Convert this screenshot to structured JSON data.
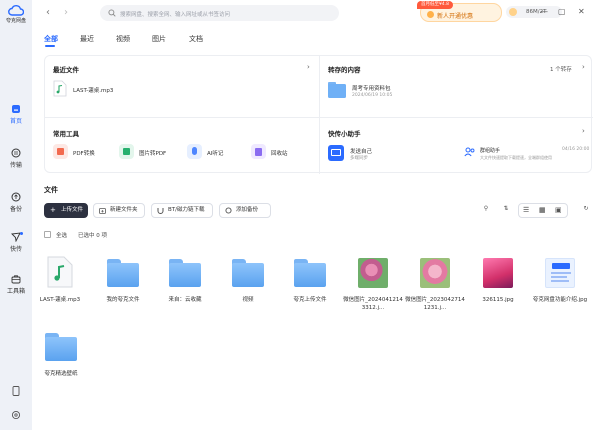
{
  "app": {
    "name": "夸克网盘"
  },
  "nav": {
    "items": [
      {
        "label": "首页",
        "icon": "home-icon",
        "active": true
      },
      {
        "label": "传输",
        "icon": "transfer-icon"
      },
      {
        "label": "备份",
        "icon": "backup-icon"
      },
      {
        "label": "快传",
        "icon": "quick-send-icon"
      },
      {
        "label": "工具箱",
        "icon": "toolbox-icon"
      }
    ]
  },
  "topbar": {
    "search_placeholder": "搜索网盘、搜索全网、输入网址或从书签访问",
    "promo_tag": "首月低至¥4.8",
    "promo_text": "新人开通优惠",
    "quota": "86M/2T"
  },
  "tabs": [
    "全部",
    "最近",
    "视频",
    "图片",
    "文档"
  ],
  "recent": {
    "title": "最近文件",
    "file": "LAST-蘧桌.mp3"
  },
  "saved": {
    "title": "转存的内容",
    "count": "1 个转存",
    "item_title": "周考专用资料包",
    "item_time": "2024/06/19 10:05"
  },
  "tools": {
    "title": "常用工具",
    "items": [
      "PDF转换",
      "图片转PDF",
      "AI听记",
      "回收站"
    ]
  },
  "helper": {
    "title": "快传小助手",
    "left_title": "发送自己",
    "left_sub": "多端同步",
    "right_title": "群组助手",
    "right_sub": "大文件快速提取下载提速，全端群组使用",
    "right_time": "04/16 20:00"
  },
  "files": {
    "title": "文件",
    "upload": "上传文件",
    "new_folder": "新建文件夹",
    "bt": "BT/磁力链下载",
    "add_backup": "添加备份",
    "select_all": "全选",
    "selected": "已选中 0 项",
    "items": [
      {
        "name": "LAST-蘧桌.mp3",
        "kind": "audio"
      },
      {
        "name": "我的夸克文件",
        "kind": "folder"
      },
      {
        "name": "来自：云收藏",
        "kind": "folder"
      },
      {
        "name": "视频",
        "kind": "folder"
      },
      {
        "name": "夸克上传文件",
        "kind": "folder"
      },
      {
        "name": "微信图片_20240412143312.j...",
        "kind": "image-pink"
      },
      {
        "name": "微信图片_20230427141231.j...",
        "kind": "image-flower"
      },
      {
        "name": "326115.jpg",
        "kind": "image-gradient"
      },
      {
        "name": "夸克网盘功能介绍.jpg",
        "kind": "image-doc"
      },
      {
        "name": "夸克精选壁纸",
        "kind": "folder"
      }
    ]
  },
  "colors": {
    "accent": "#2b6bff",
    "folder": "#6fb0f6",
    "dark_button": "#2d3140"
  }
}
